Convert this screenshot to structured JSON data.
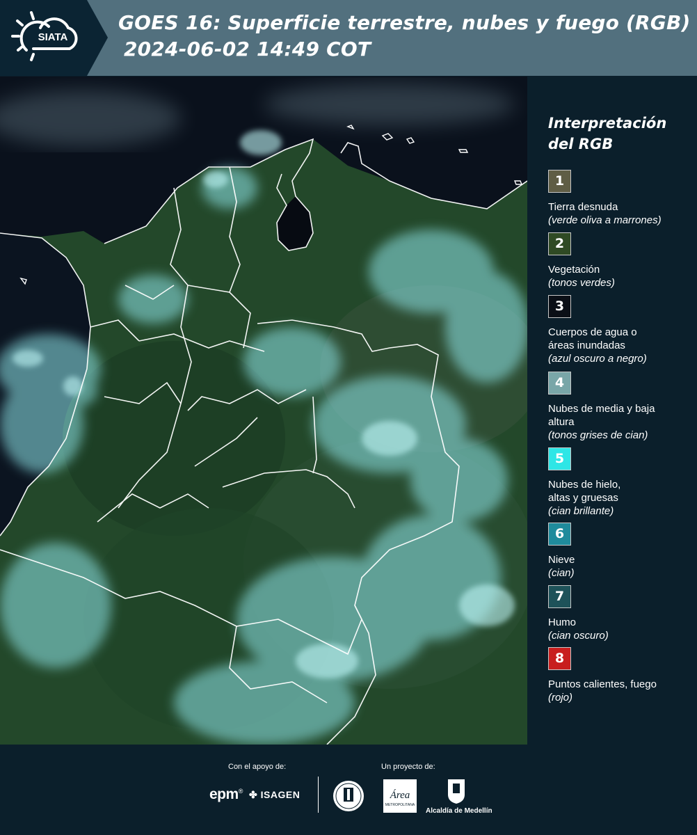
{
  "header": {
    "logo_text": "SIATA",
    "title_line1": "GOES 16: Superficie terrestre, nubes y fuego (RGB)",
    "title_line2": "2024-06-02 14:49 COT"
  },
  "map": {
    "icon": "satellite-image",
    "colors": {
      "vegetation": "#244d2c",
      "water": "#080d18",
      "clouds": "#8ee6ea",
      "borders": "#ffffff"
    }
  },
  "legend": {
    "title": "Interpretación del RGB",
    "items": [
      {
        "number": "1",
        "color": "#5f5d45",
        "label": "Tierra desnuda",
        "sub": "(verde oliva a marrones)"
      },
      {
        "number": "2",
        "color": "#2f4a24",
        "label": "Vegetación",
        "sub": "(tonos verdes)"
      },
      {
        "number": "3",
        "color": "#0b0f16",
        "label": "Cuerpos de agua o áreas inundadas",
        "sub": "(azul oscuro a negro)"
      },
      {
        "number": "4",
        "color": "#79a6a8",
        "label": "Nubes de media y baja altura",
        "sub": "(tonos grises de cian)"
      },
      {
        "number": "5",
        "color": "#2ee6e6",
        "label": "Nubes de hielo, altas y gruesas",
        "sub": "(cian brillante)"
      },
      {
        "number": "6",
        "color": "#1f8b9c",
        "label": "Nieve",
        "sub": "(cian)"
      },
      {
        "number": "7",
        "color": "#1e5259",
        "label": "Humo",
        "sub": "(cian oscuro)"
      },
      {
        "number": "8",
        "color": "#c81e1e",
        "label": "Puntos calientes, fuego",
        "sub": "(rojo)"
      }
    ]
  },
  "footer": {
    "support_label": "Con el apoyo de:",
    "project_label": "Un proyecto de:",
    "epm": "epm",
    "epm_mark": "®",
    "isagen": "ISAGEN",
    "area_logo_text": "Área",
    "area_logo_sub": "METROPOLITANA",
    "alcaldia": "Alcaldía de Medellín"
  }
}
